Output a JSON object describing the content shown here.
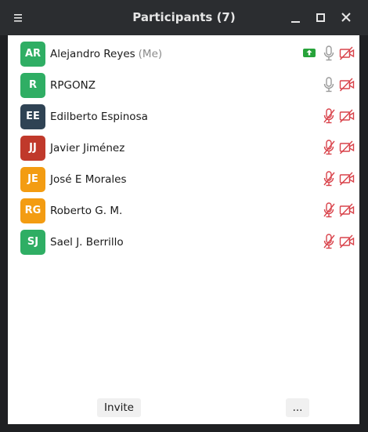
{
  "window": {
    "title": "Participants (7)"
  },
  "participants": [
    {
      "initials": "AR",
      "name": "Alejandro Reyes",
      "suffix": "(Me)",
      "color": "#2fae64",
      "mic": "on",
      "video": "off",
      "sharing": true
    },
    {
      "initials": "R",
      "name": "RPGONZ",
      "suffix": "",
      "color": "#2fae64",
      "mic": "on",
      "video": "off",
      "sharing": false
    },
    {
      "initials": "EE",
      "name": "Edilberto Espinosa",
      "suffix": "",
      "color": "#2f4354",
      "mic": "muted",
      "video": "off",
      "sharing": false
    },
    {
      "initials": "JJ",
      "name": "Javier Jiménez",
      "suffix": "",
      "color": "#c0392b",
      "mic": "muted",
      "video": "off",
      "sharing": false
    },
    {
      "initials": "JE",
      "name": "José E Morales",
      "suffix": "",
      "color": "#f39c12",
      "mic": "muted",
      "video": "off",
      "sharing": false
    },
    {
      "initials": "RG",
      "name": "Roberto G. M.",
      "suffix": "",
      "color": "#f39c12",
      "mic": "muted",
      "video": "off",
      "sharing": false
    },
    {
      "initials": "SJ",
      "name": "Sael J. Berrillo",
      "suffix": "",
      "color": "#2fae64",
      "mic": "muted",
      "video": "off",
      "sharing": false
    }
  ],
  "footer": {
    "invite_label": "Invite",
    "more_label": "..."
  },
  "icons": {
    "menu": "hamburger-menu-icon",
    "minimize": "minimize-icon",
    "maximize": "maximize-icon",
    "close": "close-icon",
    "mic_on": "microphone-icon",
    "mic_muted": "microphone-muted-icon",
    "video_off": "video-off-icon",
    "share": "screen-share-icon"
  },
  "colors": {
    "muted_red": "#d9434b",
    "mic_gray": "#9a9a9a",
    "share_green": "#27a33a"
  }
}
